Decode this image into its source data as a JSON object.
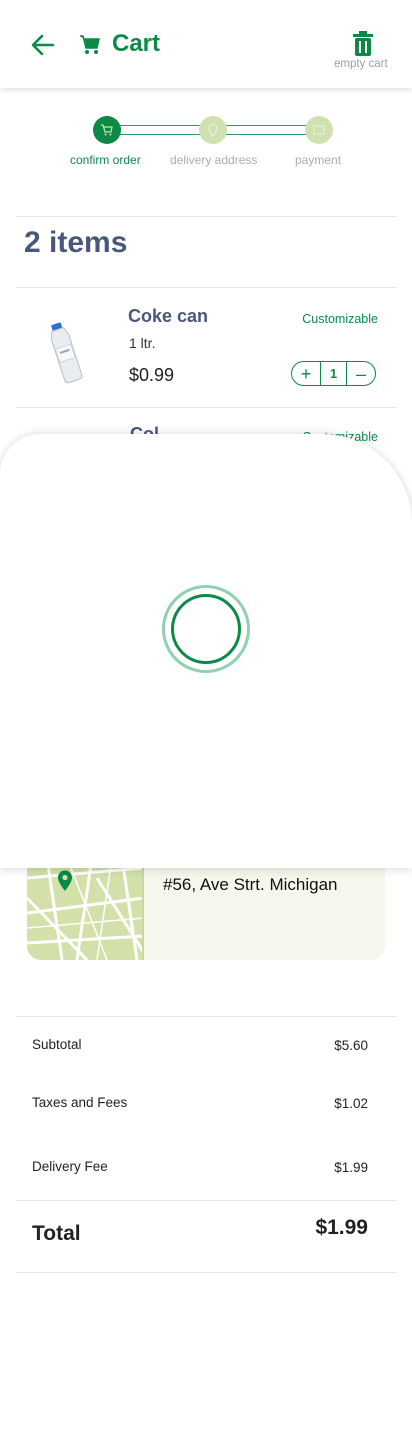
{
  "header": {
    "title": "Cart",
    "empty_cart_label": "empty cart",
    "back_icon": "arrow-left-icon",
    "cart_icon": "shopping-cart-icon",
    "trash_icon": "trash-icon"
  },
  "stepper": {
    "steps": [
      {
        "label": "confirm order",
        "icon": "cart-icon",
        "state": "active"
      },
      {
        "label": "delivery address",
        "icon": "location-pin-icon",
        "state": "inactive"
      },
      {
        "label": "payment",
        "icon": "card-icon",
        "state": "inactive"
      }
    ]
  },
  "items_count": "2 items",
  "items": [
    {
      "name": "Coke can",
      "size": "1 ltr.",
      "price": "$0.99",
      "customizable": "Customizable",
      "quantity": "1",
      "plus": "+",
      "minus": "–"
    },
    {
      "name": "Col",
      "customizable": "Customizable"
    }
  ],
  "address": {
    "text": "#56, Ave Strt. Michigan",
    "map_icon": "map-pin-icon"
  },
  "summary": {
    "subtotal_label": "Subtotal",
    "subtotal_value": "$5.60",
    "taxes_label": "Taxes and Fees",
    "taxes_value": "$1.02",
    "delivery_label": "Delivery Fee",
    "delivery_value": "$1.99",
    "total_label": "Total",
    "total_value": "$1.99"
  },
  "colors": {
    "brand_green": "#0b8a46",
    "title_blue": "#47587c",
    "inactive_step": "#cfe1b0",
    "card_bg": "#f4f7ec"
  }
}
